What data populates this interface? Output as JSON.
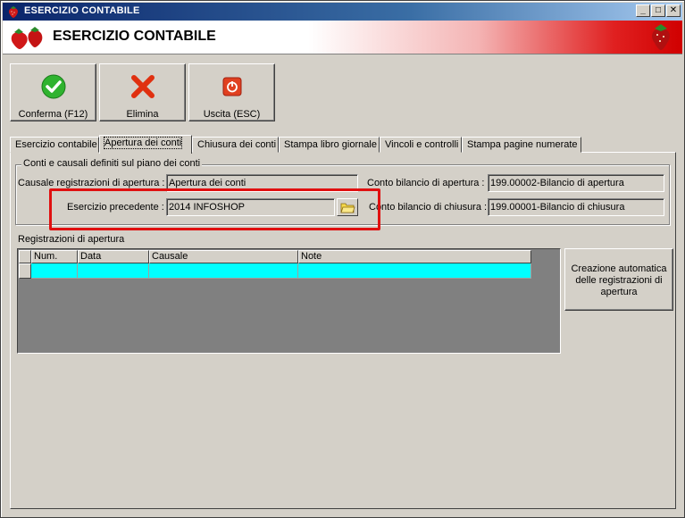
{
  "window": {
    "title": "ESERCIZIO CONTABILE",
    "controls": {
      "minimize": "_",
      "maximize": "□",
      "close": "✕"
    }
  },
  "banner": {
    "title": "ESERCIZIO CONTABILE"
  },
  "toolbar": {
    "confirm_label": "Conferma (F12)",
    "delete_label": "Elimina",
    "exit_label": "Uscita (ESC)"
  },
  "tabs": [
    {
      "label": "Esercizio contabile"
    },
    {
      "label": "Apertura dei conti"
    },
    {
      "label": "Chiusura dei conti"
    },
    {
      "label": "Stampa libro giornale"
    },
    {
      "label": "Vincoli e controlli"
    },
    {
      "label": "Stampa pagine numerate"
    }
  ],
  "group": {
    "title": "Conti e causali definiti sul piano dei conti",
    "causale_label": "Causale registrazioni di apertura :",
    "causale_value": "Apertura dei conti",
    "esercizio_label": "Esercizio precedente :",
    "esercizio_value": "2014 INFOSHOP",
    "conto_apertura_label": "Conto bilancio di apertura :",
    "conto_apertura_value": "199.00002-Bilancio di apertura",
    "conto_chiusura_label": "Conto bilancio di chiusura :",
    "conto_chiusura_value": "199.00001-Bilancio di chiusura"
  },
  "grid": {
    "label": "Registrazioni di apertura",
    "columns": [
      "Num.",
      "Data",
      "Causale",
      "Note"
    ]
  },
  "auto_button": {
    "label": "Creazione automatica delle registrazioni di apertura"
  },
  "colors": {
    "accent_red": "#e01010",
    "row_highlight": "#00ffff",
    "window_face": "#d4d0c8"
  },
  "icons": {
    "confirm": "check-circle-icon",
    "delete": "red-x-icon",
    "exit": "power-icon",
    "browse": "folder-icon",
    "logo": "strawberry-icon"
  }
}
